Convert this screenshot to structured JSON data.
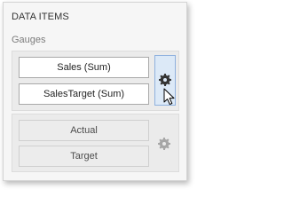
{
  "panel": {
    "title": "DATA ITEMS",
    "section_label": "Gauges"
  },
  "gauges": {
    "active_items": [
      {
        "label": "Sales (Sum)"
      },
      {
        "label": "SalesTarget (Sum)"
      }
    ],
    "placeholders": [
      {
        "label": "Actual"
      },
      {
        "label": "Target"
      }
    ]
  },
  "icons": {
    "options_active": "gear-icon",
    "options_placeholder": "gear-icon",
    "pointer": "mouse-cursor-icon"
  },
  "colors": {
    "hover_fill": "#dce9f7",
    "hover_border": "#8fb1de",
    "gear_active": "#333333",
    "gear_disabled": "#a6a6a6"
  }
}
